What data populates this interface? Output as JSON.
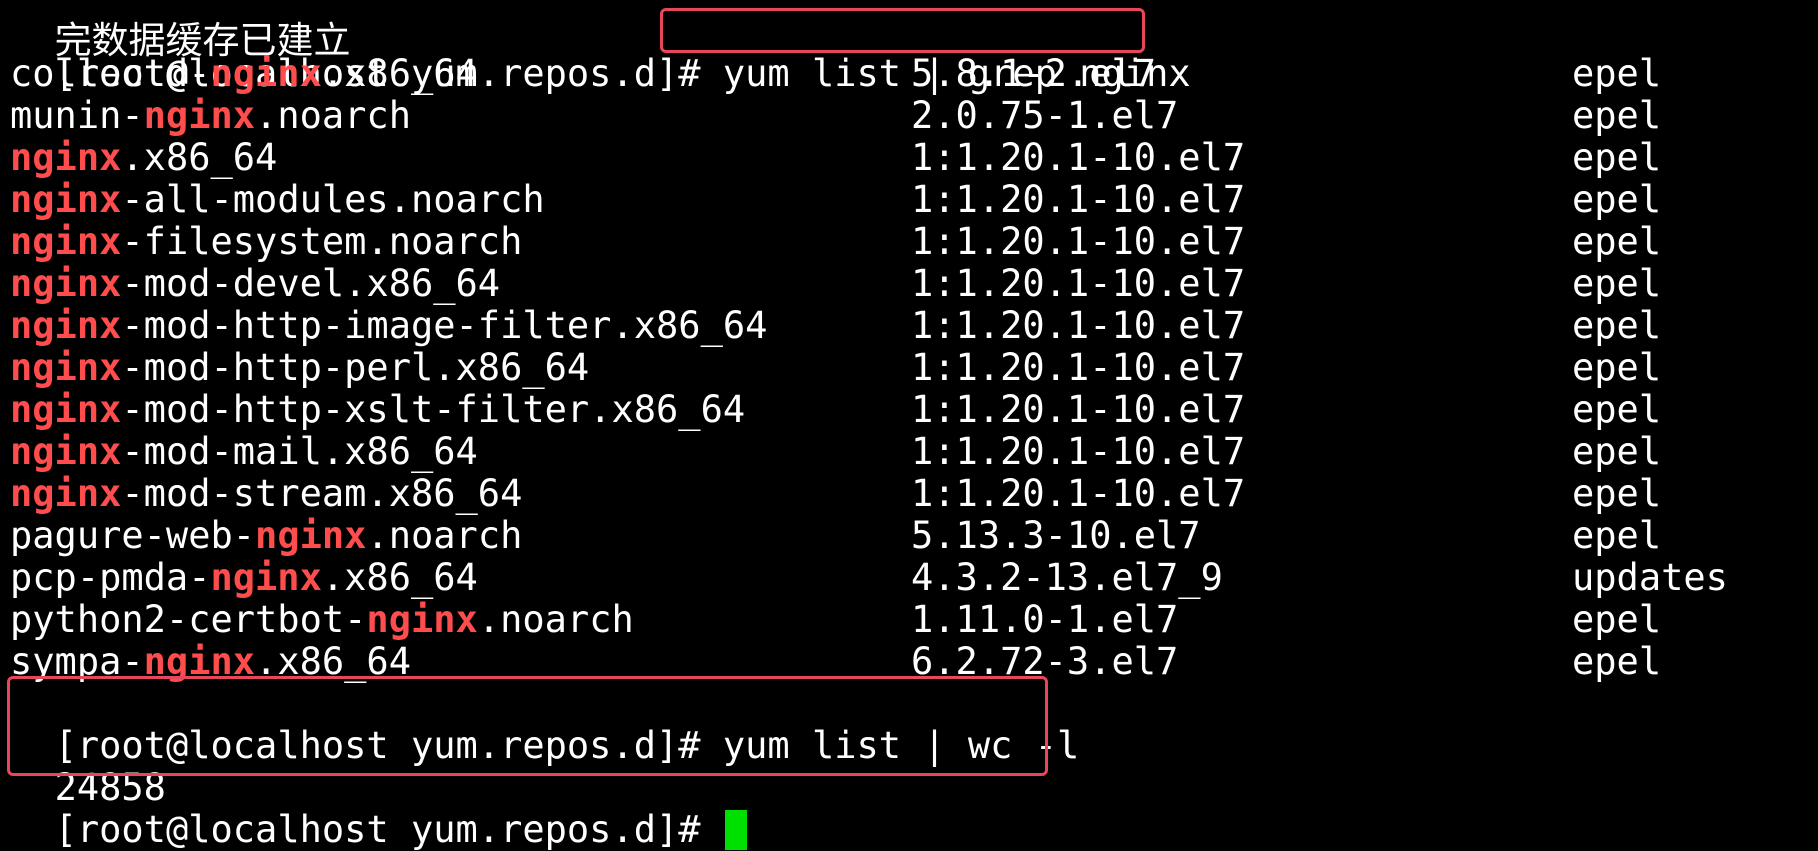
{
  "colors": {
    "background": "#000000",
    "text": "#ffffff",
    "match_highlight": "#ff4d4d",
    "annotation_box": "#e8465a",
    "cursor": "#00e000"
  },
  "top_partial_text": "完数据缓存已建立",
  "prompt": "[root@localhost yum.repos.d]# ",
  "command1": "yum list | grep nginx",
  "rows": [
    {
      "pre": "collectd-",
      "hl": "nginx",
      "post": ".x86_64",
      "version": "5.8.1-2.el7",
      "repo": "epel"
    },
    {
      "pre": "munin-",
      "hl": "nginx",
      "post": ".noarch",
      "version": "2.0.75-1.el7",
      "repo": "epel"
    },
    {
      "pre": "",
      "hl": "nginx",
      "post": ".x86_64",
      "version": "1:1.20.1-10.el7",
      "repo": "epel"
    },
    {
      "pre": "",
      "hl": "nginx",
      "post": "-all-modules.noarch",
      "version": "1:1.20.1-10.el7",
      "repo": "epel"
    },
    {
      "pre": "",
      "hl": "nginx",
      "post": "-filesystem.noarch",
      "version": "1:1.20.1-10.el7",
      "repo": "epel"
    },
    {
      "pre": "",
      "hl": "nginx",
      "post": "-mod-devel.x86_64",
      "version": "1:1.20.1-10.el7",
      "repo": "epel"
    },
    {
      "pre": "",
      "hl": "nginx",
      "post": "-mod-http-image-filter.x86_64",
      "version": "1:1.20.1-10.el7",
      "repo": "epel"
    },
    {
      "pre": "",
      "hl": "nginx",
      "post": "-mod-http-perl.x86_64",
      "version": "1:1.20.1-10.el7",
      "repo": "epel"
    },
    {
      "pre": "",
      "hl": "nginx",
      "post": "-mod-http-xslt-filter.x86_64",
      "version": "1:1.20.1-10.el7",
      "repo": "epel"
    },
    {
      "pre": "",
      "hl": "nginx",
      "post": "-mod-mail.x86_64",
      "version": "1:1.20.1-10.el7",
      "repo": "epel"
    },
    {
      "pre": "",
      "hl": "nginx",
      "post": "-mod-stream.x86_64",
      "version": "1:1.20.1-10.el7",
      "repo": "epel"
    },
    {
      "pre": "pagure-web-",
      "hl": "nginx",
      "post": ".noarch",
      "version": "5.13.3-10.el7",
      "repo": "epel"
    },
    {
      "pre": "pcp-pmda-",
      "hl": "nginx",
      "post": ".x86_64",
      "version": "4.3.2-13.el7_9",
      "repo": "updates"
    },
    {
      "pre": "python2-certbot-",
      "hl": "nginx",
      "post": ".noarch",
      "version": "1.11.0-1.el7",
      "repo": "epel"
    },
    {
      "pre": "sympa-",
      "hl": "nginx",
      "post": ".x86_64",
      "version": "6.2.72-3.el7",
      "repo": "epel"
    }
  ],
  "command2": "yum list | wc -l",
  "count_output": "24858"
}
